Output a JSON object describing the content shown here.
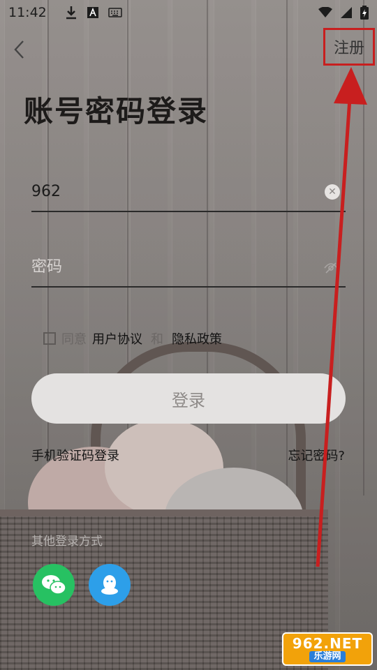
{
  "status_bar": {
    "time": "11:42"
  },
  "header": {
    "register_label": "注册"
  },
  "page": {
    "title": "账号密码登录"
  },
  "form": {
    "account_value": "962",
    "password_placeholder": "密码"
  },
  "agreement": {
    "prefix": "同意",
    "user_agreement": "用户协议",
    "and": "和",
    "privacy_policy": "隐私政策"
  },
  "actions": {
    "login_label": "登录",
    "sms_login_label": "手机验证码登录",
    "forgot_label": "忘记密码?"
  },
  "other_login": {
    "label": "其他登录方式",
    "methods": [
      "wechat-icon",
      "qq-icon"
    ]
  },
  "watermark": {
    "top": "962.NET",
    "bottom": "乐游网"
  },
  "colors": {
    "annotation_red": "#c81f1f",
    "wechat_green": "#27c162",
    "qq_blue": "#2d9fe9"
  }
}
